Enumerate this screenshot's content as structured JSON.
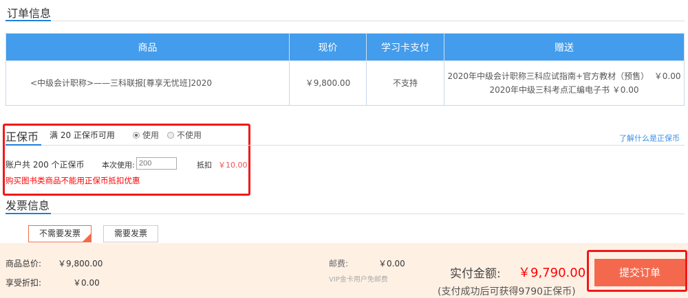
{
  "order": {
    "title": "订单信息",
    "columns": [
      "商品",
      "现价",
      "学习卡支付",
      "赠送"
    ],
    "row": {
      "product": "<中级会计职称>——三科联报[尊享无忧班]2020",
      "price": "￥9,800.00",
      "card_pay": "不支持",
      "gifts": [
        "2020年中级会计职称三科应试指南+官方教材（预售）  ￥0.00",
        "2020年中级三科考点汇编电子书 ￥0.00"
      ]
    }
  },
  "coin": {
    "title": "正保币",
    "threshold": "满 20 正保币可用",
    "use_label": "使用",
    "nouse_label": "不使用",
    "selected": "使用",
    "learn_link": "了解什么是正保币",
    "account": "账户共 200 个正保币",
    "use_label2": "本次使用:",
    "use_placeholder": "200",
    "deduct_label": "抵扣",
    "deduct_value": "￥10.00",
    "warning": "购买图书类商品不能用正保币抵扣优惠"
  },
  "invoice": {
    "title": "发票信息",
    "options": [
      "不需要发票",
      "需要发票"
    ],
    "selected": "不需要发票"
  },
  "summary": {
    "total_label": "商品总价:",
    "total": "￥9,800.00",
    "discount_label": "享受折扣:",
    "discount": "￥0.00",
    "shipping_label": "邮费:",
    "shipping": "￥0.00",
    "vip_note": "VIP金卡用户免邮费",
    "pay_label": "实付金额:",
    "pay_value": "￥9,790.00",
    "reward_note": "(支付成功后可获得9790正保币)",
    "submit": "提交订单"
  }
}
